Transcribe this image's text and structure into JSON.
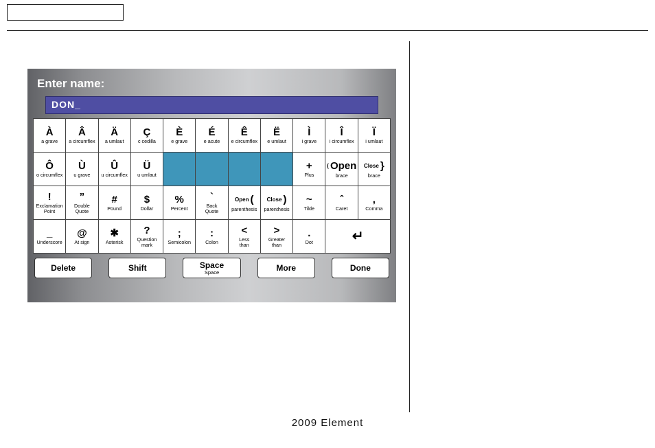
{
  "footer": "2009  Element",
  "panel": {
    "prompt": "Enter name:",
    "input_value": "DON_",
    "rows": [
      [
        {
          "g": "À",
          "l": "a grave"
        },
        {
          "g": "Â",
          "l": "a circumflex"
        },
        {
          "g": "Ä",
          "l": "a umlaut"
        },
        {
          "g": "Ç",
          "l": "c cedilla"
        },
        {
          "g": "È",
          "l": "e grave"
        },
        {
          "g": "É",
          "l": "e acute"
        },
        {
          "g": "Ê",
          "l": "e circumflex"
        },
        {
          "g": "Ë",
          "l": "e umlaut"
        },
        {
          "g": "Ì",
          "l": "i grave"
        },
        {
          "g": "Î",
          "l": "i circumflex"
        },
        {
          "g": "Ï",
          "l": "i umlaut"
        }
      ],
      [
        {
          "g": "Ô",
          "l": "o circumflex"
        },
        {
          "g": "Ù",
          "l": "u grave"
        },
        {
          "g": "Û",
          "l": "u circumflex"
        },
        {
          "g": "Ü",
          "l": "u umlaut"
        },
        {
          "g": "",
          "l": "",
          "blue": true
        },
        {
          "g": "",
          "l": "",
          "blue": true
        },
        {
          "g": "",
          "l": "",
          "blue": true
        },
        {
          "g": "",
          "l": "",
          "blue": true
        },
        {
          "g": "+",
          "l": "Plus"
        },
        {
          "g": "{ Open",
          "l": "brace",
          "open": true
        },
        {
          "g": "Close }",
          "l": "brace",
          "close": true
        }
      ],
      [
        {
          "g": "!",
          "l": "Exclamation\nPoint"
        },
        {
          "g": "”",
          "l": "Double\nQuote"
        },
        {
          "g": "#",
          "l": "Pound"
        },
        {
          "g": "$",
          "l": "Dollar"
        },
        {
          "g": "%",
          "l": "Percent"
        },
        {
          "g": "`",
          "l": "Back\nQuote"
        },
        {
          "g": "Open  (",
          "l": "parenthesis",
          "open": true
        },
        {
          "g": "Close  )",
          "l": "parenthesis",
          "close": true
        },
        {
          "g": "~",
          "l": "Tilde"
        },
        {
          "g": "ˆ",
          "l": "Caret"
        },
        {
          "g": ",",
          "l": "Comma"
        }
      ],
      [
        {
          "g": "_",
          "l": "Underscore"
        },
        {
          "g": "@",
          "l": "At sign"
        },
        {
          "g": "✱",
          "l": "Asterisk"
        },
        {
          "g": "?",
          "l": "Question\nmark"
        },
        {
          "g": ";",
          "l": "Semicolon"
        },
        {
          "g": ":",
          "l": "Colon"
        },
        {
          "g": "<",
          "l": "Less\nthan"
        },
        {
          "g": ">",
          "l": "Greater\nthan"
        },
        {
          "g": ".",
          "l": "Dot"
        },
        {
          "g": "↵",
          "l": "",
          "enter": true,
          "span": 2
        }
      ]
    ],
    "buttons": {
      "delete": "Delete",
      "shift": "Shift",
      "space": "Space",
      "space_sub": "Space",
      "more": "More",
      "done": "Done"
    }
  }
}
